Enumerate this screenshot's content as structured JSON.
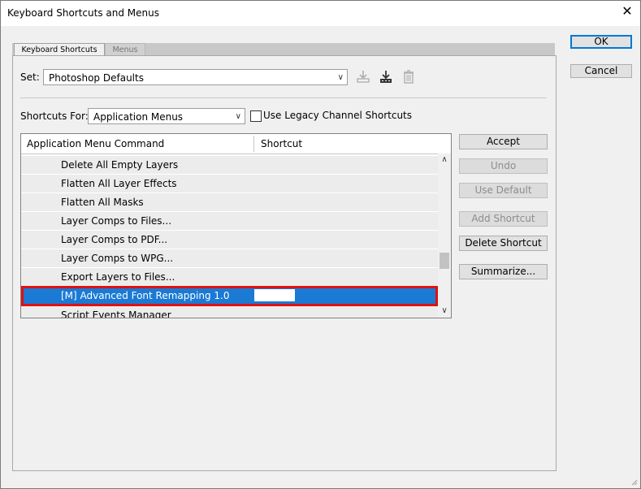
{
  "window": {
    "title": "Keyboard Shortcuts and Menus"
  },
  "tabs": [
    {
      "label": "Keyboard Shortcuts",
      "active": true
    },
    {
      "label": "Menus",
      "active": false
    }
  ],
  "set": {
    "label": "Set:",
    "value": "Photoshop Defaults"
  },
  "set_icons": [
    "save-set-icon",
    "new-set-icon",
    "delete-set-icon"
  ],
  "shortcuts_for": {
    "label": "Shortcuts For:",
    "value": "Application Menus"
  },
  "legacy_checkbox": {
    "label": "Use Legacy Channel Shortcuts",
    "checked": false
  },
  "table": {
    "headers": [
      "Application Menu Command",
      "Shortcut"
    ],
    "rows": [
      {
        "command": "Delete All Empty Layers",
        "shortcut": ""
      },
      {
        "command": "Flatten All Layer Effects",
        "shortcut": ""
      },
      {
        "command": "Flatten All Masks",
        "shortcut": ""
      },
      {
        "command": "Layer Comps to Files...",
        "shortcut": ""
      },
      {
        "command": "Layer Comps to PDF...",
        "shortcut": ""
      },
      {
        "command": "Layer Comps to WPG...",
        "shortcut": ""
      },
      {
        "command": "Export Layers to Files...",
        "shortcut": ""
      },
      {
        "command": "[M] Advanced Font Remapping 1.0",
        "shortcut": "",
        "selected": true
      },
      {
        "command": "Script Events Manager",
        "shortcut": ""
      }
    ]
  },
  "side_buttons": {
    "accept": "Accept",
    "undo": "Undo",
    "use_default": "Use Default",
    "add_shortcut": "Add Shortcut",
    "delete_shortcut": "Delete Shortcut",
    "summarize": "Summarize..."
  },
  "dialog_buttons": {
    "ok": "OK",
    "cancel": "Cancel"
  },
  "colors": {
    "selection": "#1a7ad4",
    "highlight_border": "#e01010",
    "default_button_border": "#0078d7"
  }
}
